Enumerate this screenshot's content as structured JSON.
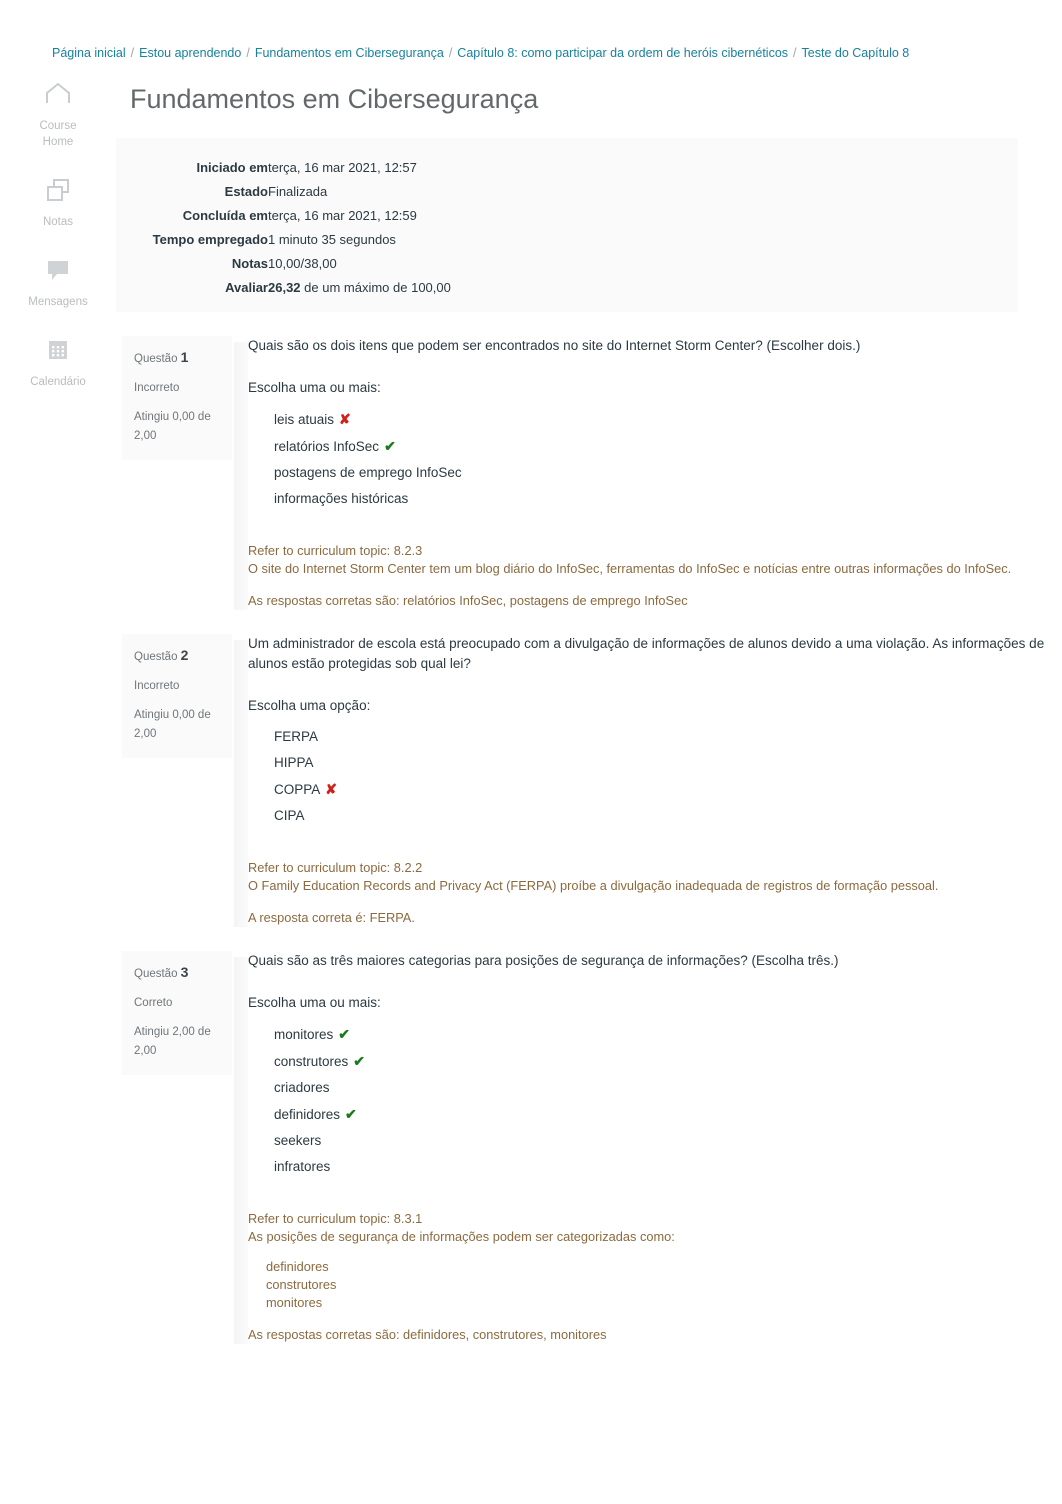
{
  "breadcrumb": {
    "items": [
      {
        "label": "Página inicial"
      },
      {
        "label": "Estou aprendendo"
      },
      {
        "label": "Fundamentos em Cibersegurança"
      },
      {
        "label": "Capítulo 8: como participar da ordem de heróis cibernéticos"
      },
      {
        "label": "Teste do Capítulo 8"
      }
    ],
    "separator": "/"
  },
  "rail": {
    "items": [
      {
        "icon": "home-icon",
        "label": "Course\nHome",
        "label_line1": "Course",
        "label_line2": "Home"
      },
      {
        "icon": "grades-icon",
        "label": "Notas"
      },
      {
        "icon": "messages-icon",
        "label": "Mensagens"
      },
      {
        "icon": "calendar-icon",
        "label": "Calendário"
      }
    ]
  },
  "page": {
    "title": "Fundamentos em Cibersegurança"
  },
  "summary": {
    "rows": [
      {
        "key": "Iniciado em",
        "value": "terça, 16 mar 2021, 12:57"
      },
      {
        "key": "Estado",
        "value": "Finalizada"
      },
      {
        "key": "Concluída em",
        "value": "terça, 16 mar 2021, 12:59"
      },
      {
        "key": "Tempo empregado",
        "value": "1 minuto 35 segundos"
      },
      {
        "key": "Notas",
        "value": "10,00/38,00"
      },
      {
        "key": "Avaliar",
        "value_bold": "26,32",
        "value": " de um máximo de 100,00"
      }
    ]
  },
  "questions": [
    {
      "number_label": "Questão",
      "number": "1",
      "state": "Incorreto",
      "grade": "Atingiu 0,00 de 2,00",
      "text": "Quais são os dois itens que podem ser encontrados no site do Internet Storm Center? (Escolher dois.)",
      "prompt": "Escolha uma ou mais:",
      "answers": [
        {
          "label": "leis atuais",
          "mark": "wrong"
        },
        {
          "label": "relatórios InfoSec",
          "mark": "correct"
        },
        {
          "label": "postagens de emprego InfoSec",
          "mark": "none"
        },
        {
          "label": "informações históricas",
          "mark": "none"
        }
      ],
      "feedback": {
        "topic": "Refer to curriculum topic: 8.2.3",
        "explanation": "O site do Internet Storm Center tem um blog diário do InfoSec, ferramentas do InfoSec e notícias entre outras informações do InfoSec.",
        "list": [],
        "answer": "As respostas corretas são: relatórios InfoSec, postagens de emprego InfoSec"
      }
    },
    {
      "number_label": "Questão",
      "number": "2",
      "state": "Incorreto",
      "grade": "Atingiu 0,00 de 2,00",
      "text": "Um administrador de escola está preocupado com a divulgação de informações de alunos devido a uma violação. As informações de alunos estão protegidas sob qual lei?",
      "prompt": "Escolha uma opção:",
      "answers": [
        {
          "label": "FERPA",
          "mark": "none"
        },
        {
          "label": "HIPPA",
          "mark": "none"
        },
        {
          "label": "COPPA",
          "mark": "wrong"
        },
        {
          "label": "CIPA",
          "mark": "none"
        }
      ],
      "feedback": {
        "topic": "Refer to curriculum topic: 8.2.2",
        "explanation": "O Family Education Records and Privacy Act (FERPA) proíbe a divulgação inadequada de registros de formação pessoal.",
        "list": [],
        "answer": "A resposta correta é: FERPA."
      }
    },
    {
      "number_label": "Questão",
      "number": "3",
      "state": "Correto",
      "grade": "Atingiu 2,00 de 2,00",
      "text": "Quais são as três maiores categorias para posições de segurança de informações? (Escolha três.)",
      "prompt": "Escolha uma ou mais:",
      "answers": [
        {
          "label": "monitores",
          "mark": "correct"
        },
        {
          "label": "construtores",
          "mark": "correct"
        },
        {
          "label": "criadores",
          "mark": "none"
        },
        {
          "label": "definidores",
          "mark": "correct"
        },
        {
          "label": "seekers",
          "mark": "none"
        },
        {
          "label": "infratores",
          "mark": "none"
        }
      ],
      "feedback": {
        "topic": "Refer to curriculum topic: 8.3.1",
        "explanation": "As posições de segurança de informações podem ser categorizadas como:",
        "list": [
          "definidores",
          "construtores",
          "monitores"
        ],
        "answer": "As respostas corretas são: definidores, construtores, monitores"
      }
    }
  ],
  "marks": {
    "correct_glyph": "✔",
    "wrong_glyph": "✘"
  },
  "colors": {
    "link": "#17829e",
    "feedback": "#8c6a3f",
    "correct": "#1b7a1f",
    "wrong": "#d0201a",
    "title": "#63696b"
  }
}
